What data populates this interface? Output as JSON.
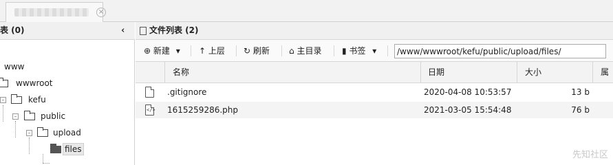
{
  "tab": {
    "title": "",
    "close_icon": "×"
  },
  "left_panel": {
    "title": "表 (0)",
    "collapse_icon": "‹",
    "tree": [
      {
        "label": "www"
      },
      {
        "label": "wwwroot"
      },
      {
        "label": "kefu"
      },
      {
        "label": "public"
      },
      {
        "label": "upload"
      },
      {
        "label": "files"
      }
    ]
  },
  "right_panel": {
    "title": "文件列表 (2)",
    "toolbar": {
      "new_label": "新建",
      "up_label": "上层",
      "refresh_label": "刷新",
      "home_label": "主目录",
      "bookmark_label": "书签",
      "path_value": "/www/wwwroot/kefu/public/upload/files/"
    },
    "columns": {
      "name": "名称",
      "date": "日期",
      "size": "大小",
      "attr": "属性"
    },
    "files": [
      {
        "name": ".gitignore",
        "date": "2020-04-08 10:53:57",
        "size": "13 b"
      },
      {
        "name": "1615259286.php",
        "date": "2021-03-05 15:54:48",
        "size": "76 b"
      }
    ]
  },
  "watermark": "先知社区"
}
